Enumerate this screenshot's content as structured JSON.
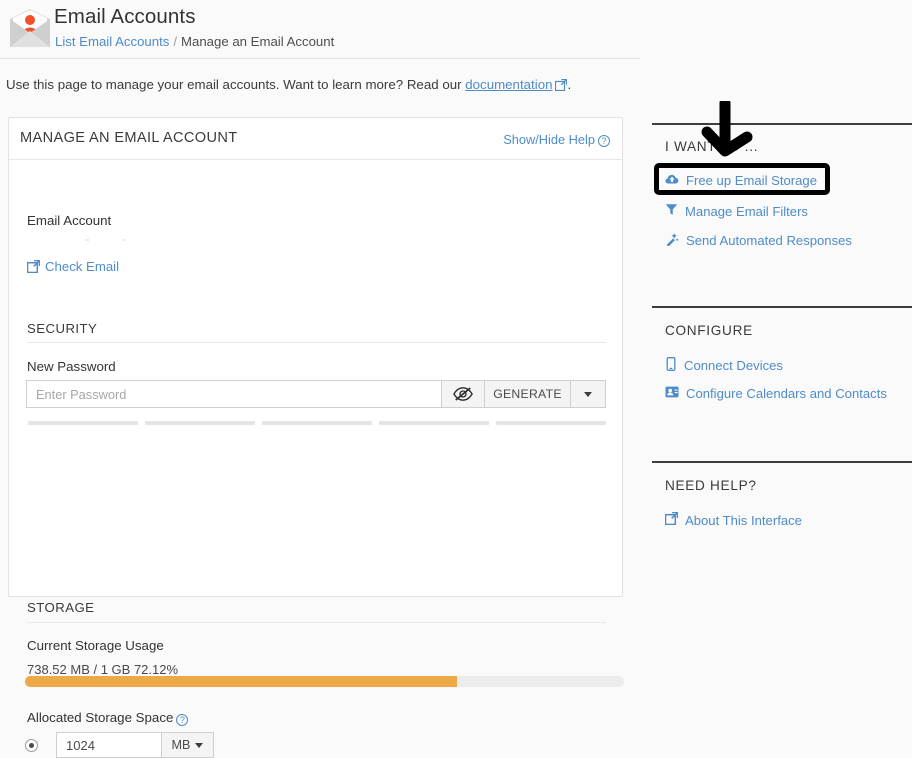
{
  "header": {
    "title": "Email Accounts",
    "logo_icon": "envelope-user-icon",
    "breadcrumb": {
      "parent_label": "List Email Accounts",
      "separator": "/",
      "current_label": "Manage an Email Account"
    }
  },
  "intro": {
    "text_before": "Use this page to manage your email accounts. Want to learn more? Read our",
    "link_label": "documentation",
    "link_icon": "external-link-icon",
    "text_after": "."
  },
  "card": {
    "title": "MANAGE AN EMAIL ACCOUNT",
    "show_hide_help": "Show/Hide Help",
    "help_icon": "question-circle-icon",
    "email_account_label": "Email Account",
    "email_account_value": "",
    "check_email_label": "Check Email",
    "check_email_icon": "external-link-icon",
    "security": {
      "section_title": "SECURITY",
      "new_password_label": "New Password",
      "password_value": "",
      "password_placeholder": "Enter Password",
      "eye_icon": "eye-slash-icon",
      "generate_label": "GENERATE",
      "caret_icon": "chevron-down-icon",
      "strength_segments": 5
    },
    "storage": {
      "section_title": "STORAGE",
      "current_usage_label": "Current Storage Usage",
      "usage_text": "738.52 MB / 1 GB 72.12%",
      "usage_percent": 72.12,
      "bar_color": "#eda847",
      "bar_track_color": "#ececec",
      "allocated_label": "Allocated Storage Space",
      "allocated_help_icon": "question-circle-icon",
      "allocated_value": "1024",
      "allocated_unit": "MB",
      "unit_caret_icon": "chevron-down-icon",
      "radio_selected": true
    }
  },
  "sidebar": {
    "groups": [
      {
        "title": "I WANT TO ...",
        "links": [
          {
            "label": "Free up Email Storage",
            "icon": "cloud-upload-icon",
            "highlighted": true
          },
          {
            "label": "Manage Email Filters",
            "icon": "filter-icon",
            "highlighted": false
          },
          {
            "label": "Send Automated Responses",
            "icon": "magic-wand-icon",
            "highlighted": false
          }
        ]
      },
      {
        "title": "CONFIGURE",
        "links": [
          {
            "label": "Connect Devices",
            "icon": "mobile-device-icon",
            "highlighted": false
          },
          {
            "label": "Configure Calendars and Contacts",
            "icon": "address-card-icon",
            "highlighted": false
          }
        ]
      },
      {
        "title": "NEED HELP?",
        "links": [
          {
            "label": "About This Interface",
            "icon": "external-link-icon",
            "highlighted": false
          }
        ]
      }
    ]
  },
  "annotations": {
    "arrow_icon": "down-arrow-annotation",
    "box_icon": "highlight-rectangle-annotation",
    "color": "#000000"
  },
  "colors": {
    "link": "#4f8cc9",
    "accent_orange": "#eda847",
    "logo_orange": "#f0502a",
    "page_background": "#fafafa"
  }
}
